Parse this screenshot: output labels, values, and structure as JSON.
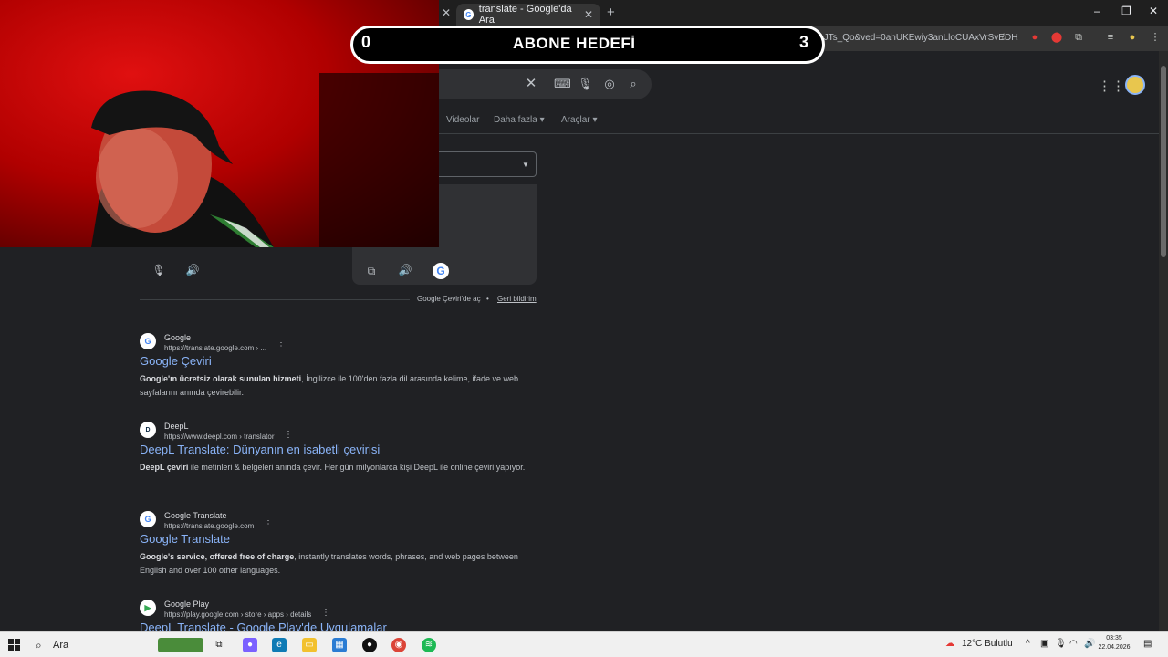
{
  "browser": {
    "active_tab_title": "translate - Google'da Ara",
    "url": "ANbL-n6oWGOwTNN7Y4NY24e5QIxzMyXZl4c%3A17175837854041&ei=1hLoabKaAuuUxc8P-JTs_Qo&ved=0ahUKEwiy3anLloCUAxVrSvEDHXgKO...",
    "new_tab_label": "+",
    "window_controls": [
      "–",
      "❐",
      "✕"
    ]
  },
  "search_nav": {
    "tabs": [
      "Videolar",
      "Daha fazla",
      "Araçlar"
    ]
  },
  "translate_footer": {
    "open_label": "Google Çeviri'de aç",
    "separator": "•",
    "feedback_label": "Geri bildirim"
  },
  "results": [
    {
      "site": "Google",
      "url": "https://translate.google.com › ...",
      "title": "Google Çeviri",
      "snippet_bold": "Google'ın ücretsiz olarak sunulan hizmeti",
      "snippet": ", İngilizce ile 100'den fazla dil arasında kelime, ifade ve web sayfalarını anında çevirebilir.",
      "icon_letter": "G"
    },
    {
      "site": "DeepL",
      "url": "https://www.deepl.com › translator",
      "title": "DeepL Translate: Dünyanın en isabetli çevirisi",
      "snippet_bold": "DeepL çeviri",
      "snippet": " ile metinleri & belgeleri anında çevir. Her gün milyonlarca kişi DeepL ile online çeviri yapıyor.",
      "icon_letter": "D"
    },
    {
      "site": "Google Translate",
      "url": "https://translate.google.com",
      "title": "Google Translate",
      "snippet_bold": "Google's service, offered free of charge",
      "snippet": ", instantly translates words, phrases, and web pages between English and over 100 other languages.",
      "icon_letter": "G"
    },
    {
      "site": "Google Play",
      "url": "https://play.google.com › store › apps › details",
      "title": "DeepL Translate - Google Play'de Uygulamalar",
      "snippet_bold": "",
      "snippet": "",
      "icon_letter": "▶"
    }
  ],
  "overlay": {
    "left_value": "0",
    "label": "ABONE HEDEFİ",
    "right_value": "3"
  },
  "taskbar": {
    "search_label": "Ara",
    "weather": "12°C  Bulutlu",
    "time": "03:35",
    "date": "22.04.2026"
  },
  "colors": {
    "page_bg": "#202124",
    "link": "#8ab4f8",
    "webcam_red": "#c00000"
  }
}
